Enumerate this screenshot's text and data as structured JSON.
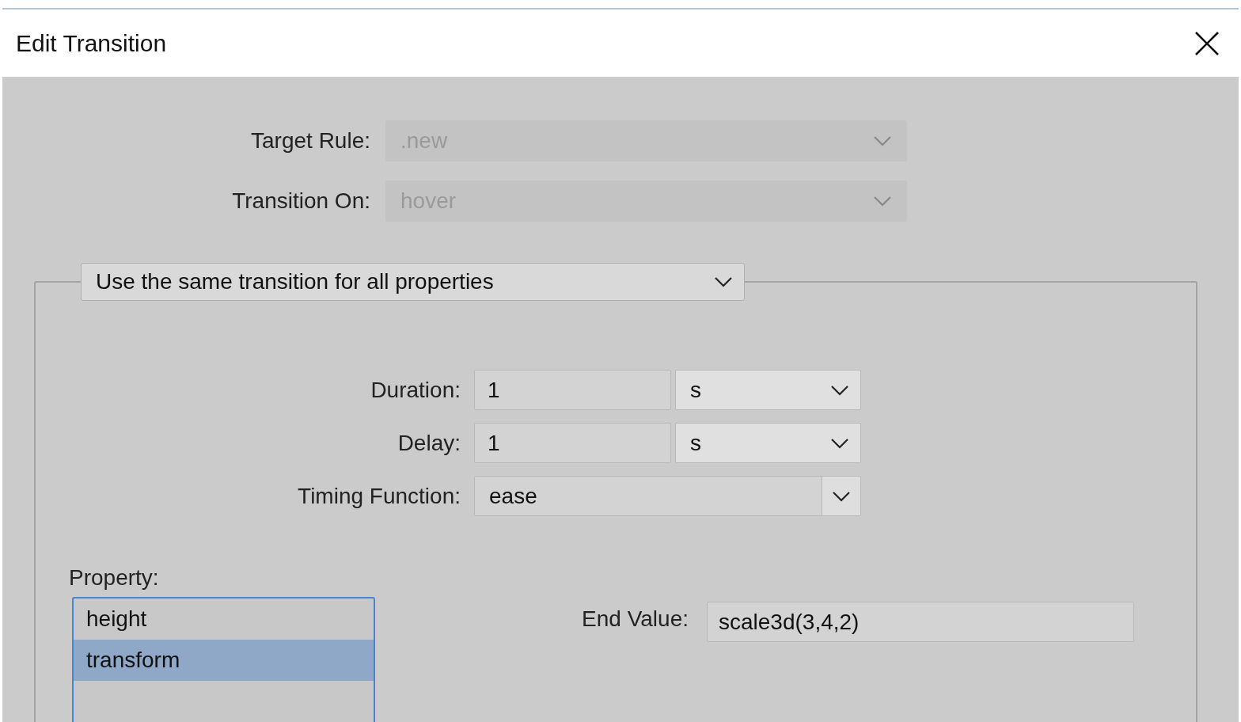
{
  "window": {
    "title": "Edit Transition"
  },
  "fields": [
    {
      "label": "Target Rule:",
      "value": ".new",
      "disabled": true
    },
    {
      "label": "Transition On:",
      "value": "hover",
      "disabled": true
    }
  ],
  "mode_dropdown": {
    "value": "Use the same transition for all properties"
  },
  "timing": [
    {
      "kind": "unit",
      "label": "Duration:",
      "value": "1",
      "unit": "s"
    },
    {
      "kind": "unit",
      "label": "Delay:",
      "value": "1",
      "unit": "s"
    },
    {
      "kind": "select",
      "label": "Timing Function:",
      "value": "ease"
    }
  ],
  "property": {
    "label": "Property:",
    "items": [
      {
        "name": "height",
        "selected": false
      },
      {
        "name": "transform",
        "selected": true
      }
    ]
  },
  "end_value": {
    "label": "End Value:",
    "value": "scale3d(3,4,2)"
  }
}
